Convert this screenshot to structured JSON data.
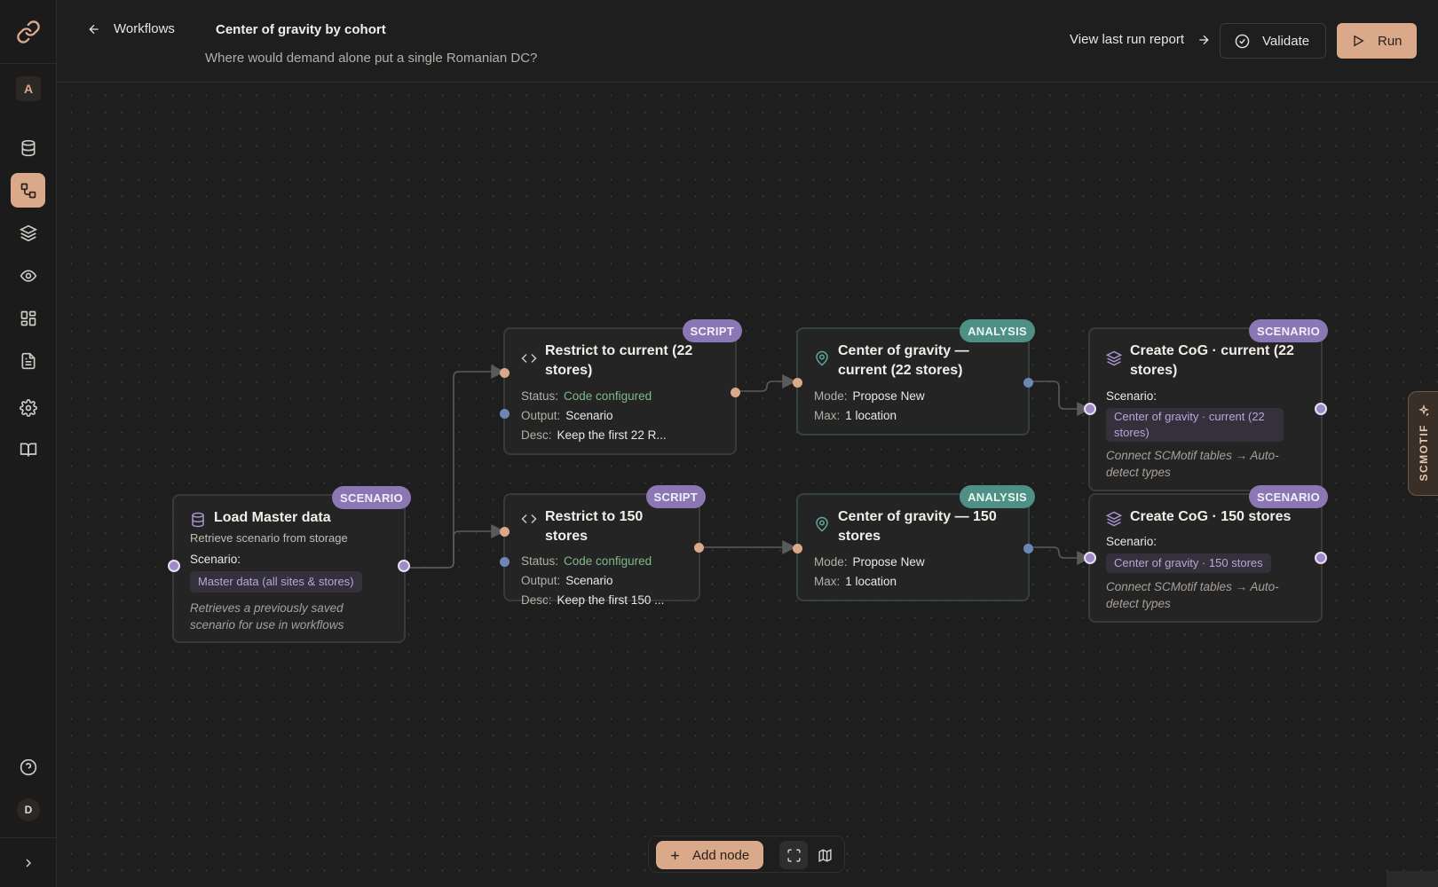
{
  "sidebar": {
    "workspace_initial": "A",
    "user_initial": "D",
    "items": [
      {
        "icon": "database-icon"
      },
      {
        "icon": "workflow-icon",
        "active": true
      },
      {
        "icon": "layers-icon"
      },
      {
        "icon": "eye-icon"
      },
      {
        "icon": "dashboard-icon"
      },
      {
        "icon": "document-icon"
      },
      {
        "icon": "settings-icon"
      },
      {
        "icon": "book-icon"
      }
    ]
  },
  "header": {
    "back_label": "Workflows",
    "title": "Center of gravity by cohort",
    "subtitle": "Where would demand alone put a single Romanian DC?",
    "view_report_label": "View last run report",
    "validate_label": "Validate",
    "run_label": "Run",
    "accent_color": "#d9a98a"
  },
  "nodes": {
    "load": {
      "badge": "SCENARIO",
      "title": "Load Master data",
      "desc": "Retrieve scenario from storage",
      "scenario_label": "Scenario:",
      "scenario_value": "Master data (all sites & stores)",
      "note": "Retrieves a previously saved scenario for use in workflows"
    },
    "restrict22": {
      "badge": "SCRIPT",
      "title": "Restrict to current (22 stores)",
      "status_label": "Status:",
      "status_value": "Code configured",
      "output_label": "Output:",
      "output_value": "Scenario",
      "desc_label": "Desc:",
      "desc_value": "Keep the first 22 R..."
    },
    "restrict150": {
      "badge": "SCRIPT",
      "title": "Restrict to 150 stores",
      "status_label": "Status:",
      "status_value": "Code configured",
      "output_label": "Output:",
      "output_value": "Scenario",
      "desc_label": "Desc:",
      "desc_value": "Keep the first 150 ..."
    },
    "cog22": {
      "badge": "ANALYSIS",
      "title": "Center of gravity — current (22 stores)",
      "mode_label": "Mode:",
      "mode_value": "Propose New",
      "max_label": "Max:",
      "max_value": "1 location"
    },
    "cog150": {
      "badge": "ANALYSIS",
      "title": "Center of gravity — 150 stores",
      "mode_label": "Mode:",
      "mode_value": "Propose New",
      "max_label": "Max:",
      "max_value": "1 location"
    },
    "create22": {
      "badge": "SCENARIO",
      "title": "Create CoG · current (22 stores)",
      "scenario_label": "Scenario:",
      "scenario_value": "Center of gravity · current (22 stores)",
      "note": "Connect SCMotif tables → Auto-detect types"
    },
    "create150": {
      "badge": "SCENARIO",
      "title": "Create CoG · 150 stores",
      "scenario_label": "Scenario:",
      "scenario_value": "Center of gravity · 150 stores",
      "note": "Connect SCMotif tables → Auto-detect types"
    }
  },
  "toolbar": {
    "add_node_label": "Add node"
  },
  "side_tab": {
    "label": "SCMOTIF"
  }
}
